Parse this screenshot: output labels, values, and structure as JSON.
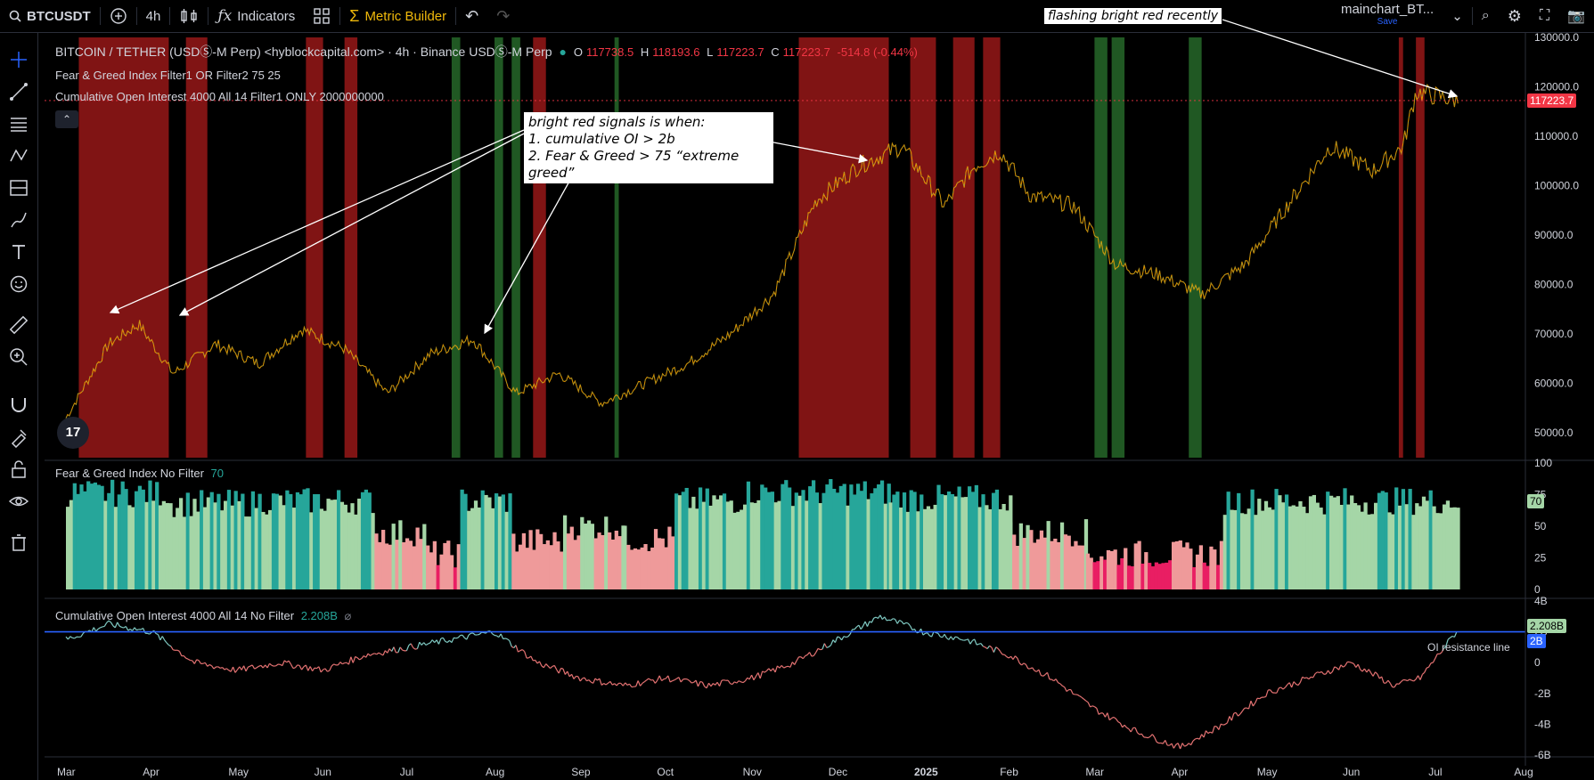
{
  "toolbar": {
    "symbol": "BTCUSDT",
    "interval": "4h",
    "indicators_label": "Indicators",
    "metric_builder_label": "Metric Builder",
    "layout_name": "mainchart_BT...",
    "layout_save": "Save"
  },
  "legend": {
    "main_title": "BITCOIN / TETHER (USDⓈ-M Perp) <hyblockcapital.com> · 4h · Binance USDⓈ-M Perp",
    "ohlc": {
      "o_label": "O",
      "o": "117738.5",
      "h_label": "H",
      "h": "118193.6",
      "l_label": "L",
      "l": "117223.7",
      "c_label": "C",
      "c": "117223.7",
      "chg": "-514.8 (-0.44%)"
    },
    "indicator1": "Fear & Greed Index Filter1 OR Filter2 75 25",
    "indicator2": "Cumulative Open Interest 4000 All 14 Filter1 ONLY 2000000000",
    "fg_title": "Fear & Greed Index No Filter",
    "fg_value": "70",
    "oi_title": "Cumulative Open Interest 4000 All 14 No Filter",
    "oi_value": "2.208B",
    "oi_line_label": "OI resistance line"
  },
  "annotations": {
    "top": "flashing bright red recently",
    "box_line1": "bright red signals is when:",
    "box_line2": "1. cumulative OI > 2b",
    "box_line3": "2. Fear & Greed > 75 “extreme greed”"
  },
  "logo": "17",
  "colors": {
    "up": "#26a69a",
    "down": "#f23645",
    "price_line": "#f7a600",
    "red_zone": "#b71c1c",
    "green_zone": "#2e7d32",
    "oi_line": "#2962ff",
    "fg_extreme_greed": "#26a69a",
    "fg_greed": "#a5d6a7",
    "fg_fear": "#ef9a9a",
    "fg_extreme_fear": "#e91e63"
  },
  "chart_data": [
    {
      "type": "line",
      "price_axis_ticks": [
        "130000.0",
        "120000.0",
        "110000.0",
        "100000.0",
        "90000.0",
        "80000.0",
        "70000.0",
        "60000.0",
        "50000.0"
      ],
      "current_price": "117223.7",
      "x": [
        0,
        0.5,
        0.85,
        1.25,
        1.75,
        2.25,
        2.75,
        3.25,
        3.75,
        4.25,
        4.75,
        5.25,
        5.75,
        6.25,
        6.75,
        7.25,
        7.75,
        8.25,
        8.75,
        9.25,
        9.75,
        10.25,
        10.6,
        10.9,
        11.25,
        11.75,
        12.25,
        12.75,
        13.25,
        13.75,
        14.25,
        14.75,
        15.25,
        15.6,
        15.75,
        16.25
      ],
      "values": [
        53000,
        68000,
        72000,
        62000,
        68000,
        64000,
        71000,
        67000,
        58000,
        66000,
        69000,
        58000,
        62000,
        56000,
        60000,
        64000,
        70000,
        78000,
        97000,
        104000,
        108000,
        96000,
        104000,
        107000,
        98000,
        96000,
        84000,
        82000,
        78000,
        84000,
        96000,
        108000,
        103000,
        108000,
        119000,
        117223
      ],
      "ylim": [
        45000,
        130000
      ],
      "red_zones": [
        [
          0.15,
          1.2
        ],
        [
          1.4,
          1.65
        ],
        [
          2.8,
          3.0
        ],
        [
          3.25,
          3.4
        ],
        [
          5.45,
          5.6
        ],
        [
          8.55,
          9.6
        ],
        [
          9.85,
          10.15
        ],
        [
          10.35,
          10.6
        ],
        [
          10.7,
          10.9
        ],
        [
          15.55,
          15.6
        ],
        [
          15.75,
          15.85
        ]
      ],
      "green_zones": [
        [
          4.5,
          4.6
        ],
        [
          5.0,
          5.1
        ],
        [
          5.2,
          5.3
        ],
        [
          6.4,
          6.45
        ],
        [
          12.0,
          12.15
        ],
        [
          12.2,
          12.35
        ],
        [
          13.1,
          13.25
        ]
      ]
    },
    {
      "type": "bar",
      "title": "Fear & Greed Index No Filter",
      "y_ticks": [
        "100",
        "75",
        "50",
        "25",
        "0"
      ],
      "ylim": [
        0,
        100
      ],
      "segments": [
        {
          "from": 0,
          "to": 1.2,
          "value": 76
        },
        {
          "from": 1.2,
          "to": 2.2,
          "value": 68
        },
        {
          "from": 2.2,
          "to": 3.6,
          "value": 70
        },
        {
          "from": 3.6,
          "to": 4.2,
          "value": 45
        },
        {
          "from": 4.2,
          "to": 4.6,
          "value": 28
        },
        {
          "from": 4.6,
          "to": 5.2,
          "value": 70
        },
        {
          "from": 5.2,
          "to": 5.8,
          "value": 38
        },
        {
          "from": 5.8,
          "to": 6.5,
          "value": 50
        },
        {
          "from": 6.5,
          "to": 7.1,
          "value": 40
        },
        {
          "from": 7.1,
          "to": 7.9,
          "value": 70
        },
        {
          "from": 7.9,
          "to": 9.6,
          "value": 77
        },
        {
          "from": 9.6,
          "to": 11.0,
          "value": 72
        },
        {
          "from": 11.0,
          "to": 11.9,
          "value": 45
        },
        {
          "from": 11.9,
          "to": 13.5,
          "value": 28
        },
        {
          "from": 13.5,
          "to": 16.25,
          "value": 70
        }
      ],
      "current_value": "70"
    },
    {
      "type": "line",
      "title": "Cumulative Open Interest 4000 All 14 No Filter",
      "y_ticks": [
        "4B",
        "2B",
        "0",
        "-2B",
        "-4B",
        "-6B"
      ],
      "ylim": [
        -6,
        4
      ],
      "x": [
        0,
        0.5,
        1.0,
        1.5,
        2.0,
        2.5,
        3.0,
        3.5,
        4.0,
        4.5,
        5.0,
        5.5,
        6.0,
        6.5,
        7.0,
        7.5,
        8.0,
        8.5,
        9.0,
        9.5,
        10.0,
        10.5,
        11.0,
        11.5,
        12.0,
        12.5,
        13.0,
        13.5,
        14.0,
        14.5,
        15.0,
        15.5,
        15.8,
        16.25
      ],
      "values": [
        1.5,
        2.5,
        2.0,
        0.0,
        -0.5,
        0.0,
        -0.5,
        0.5,
        1.0,
        1.5,
        2.0,
        0.0,
        -1.0,
        -1.5,
        -1.0,
        -1.5,
        -1.0,
        0.0,
        1.5,
        3.0,
        2.0,
        1.5,
        0.5,
        -1.0,
        -3.0,
        -4.5,
        -5.5,
        -4.0,
        -2.0,
        -1.0,
        0.0,
        -1.5,
        -1.0,
        2.2
      ],
      "threshold": 2,
      "threshold_label": "2B",
      "current_value": "2.208B"
    }
  ],
  "x_axis": {
    "labels": [
      "Mar",
      "Apr",
      "May",
      "Jun",
      "Jul",
      "Aug",
      "Sep",
      "Oct",
      "Nov",
      "Dec",
      "2025",
      "Feb",
      "Mar",
      "Apr",
      "May",
      "Jun",
      "Jul",
      "Aug"
    ],
    "positions": [
      0,
      1,
      2,
      3,
      4,
      5,
      6,
      7,
      8,
      9,
      10,
      11,
      12,
      13,
      14,
      15,
      16,
      17
    ]
  }
}
